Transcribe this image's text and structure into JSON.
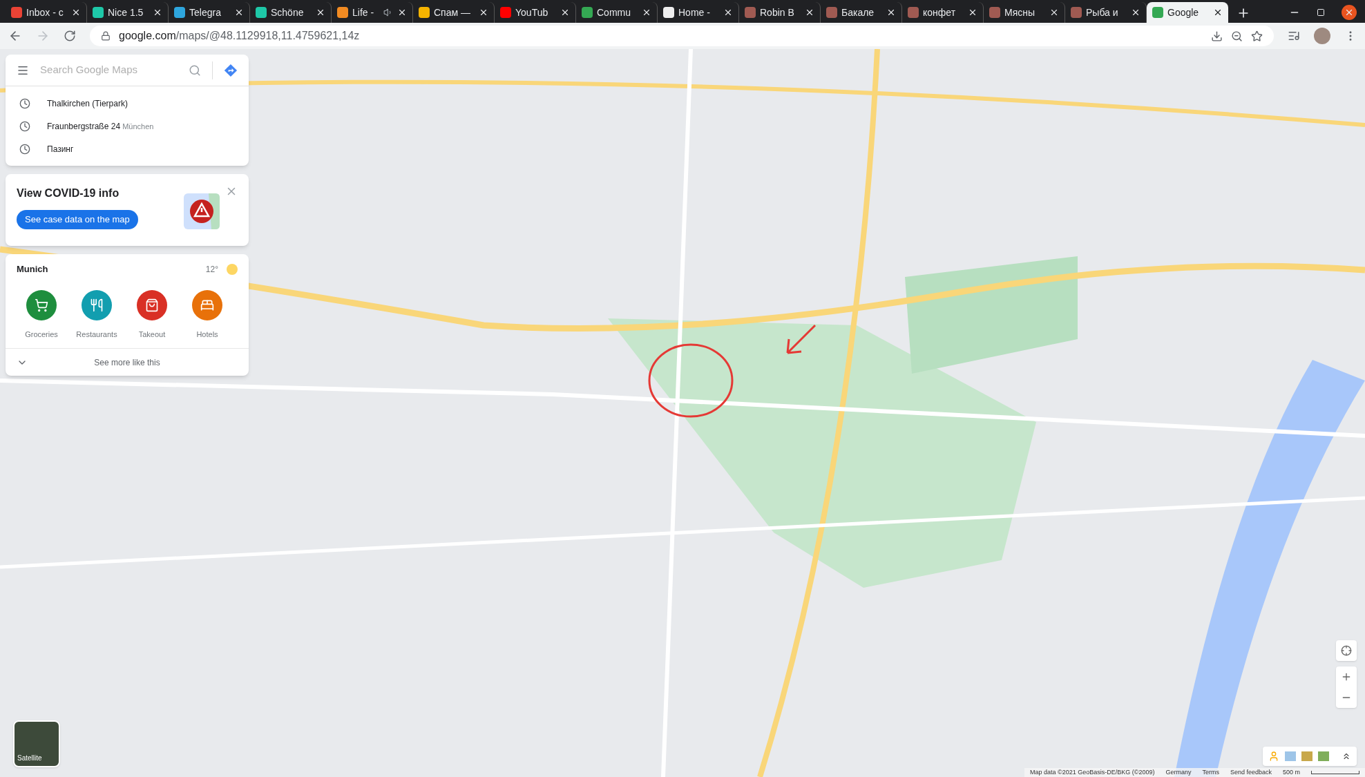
{
  "tabs": [
    {
      "title": "Inbox - c",
      "color": "#ea4335",
      "audio": false,
      "selected": false
    },
    {
      "title": "Nice 1.5",
      "color": "#1ec8a8",
      "audio": false,
      "selected": false
    },
    {
      "title": "Telegra",
      "color": "#2ea6de",
      "audio": false,
      "selected": false
    },
    {
      "title": "Schöne",
      "color": "#1ec8a8",
      "audio": false,
      "selected": false
    },
    {
      "title": "Life -",
      "color": "#f28b22",
      "audio": true,
      "selected": false
    },
    {
      "title": "Спам —",
      "color": "#f6b400",
      "audio": false,
      "selected": false
    },
    {
      "title": "YouTub",
      "color": "#ff0000",
      "audio": false,
      "selected": false
    },
    {
      "title": "Commu",
      "color": "#34a853",
      "audio": false,
      "selected": false
    },
    {
      "title": "Home -",
      "color": "#eeeeee",
      "audio": false,
      "selected": false
    },
    {
      "title": "Robin B",
      "color": "#a05a52",
      "audio": false,
      "selected": false
    },
    {
      "title": "Бакале",
      "color": "#a05a52",
      "audio": false,
      "selected": false
    },
    {
      "title": "конфет",
      "color": "#a05a52",
      "audio": false,
      "selected": false
    },
    {
      "title": "Мясны",
      "color": "#a05a52",
      "audio": false,
      "selected": false
    },
    {
      "title": "Рыба и",
      "color": "#a05a52",
      "audio": false,
      "selected": false
    },
    {
      "title": "Google",
      "color": "#34a853",
      "audio": false,
      "selected": true
    }
  ],
  "address_bar": {
    "host": "google.com",
    "path": "/maps/@48.1129918,11.4759621,14z"
  },
  "search": {
    "placeholder": "Search Google Maps"
  },
  "history": [
    {
      "name": "Thalkirchen (Tierpark)"
    },
    {
      "name": "Fraunbergstraße 24",
      "detail": "München"
    },
    {
      "name": "Пазинг"
    }
  ],
  "covid_card": {
    "title": "View COVID-19 info",
    "button": "See case data on the map"
  },
  "city_card": {
    "city": "Munich",
    "temperature": "12°",
    "categories": [
      {
        "label": "Groceries",
        "color": "#1e8e3e"
      },
      {
        "label": "Restaurants",
        "color": "#129eaf"
      },
      {
        "label": "Takeout",
        "color": "#d93025"
      },
      {
        "label": "Hotels",
        "color": "#e8710a"
      }
    ],
    "more": "See more like this"
  },
  "satellite": {
    "label": "Satellite"
  },
  "footer": [
    "Map data ©2021 GeoBasis-DE/BKG (©2009)",
    "Germany",
    "Terms",
    "Send feedback"
  ],
  "scale": "500 m"
}
